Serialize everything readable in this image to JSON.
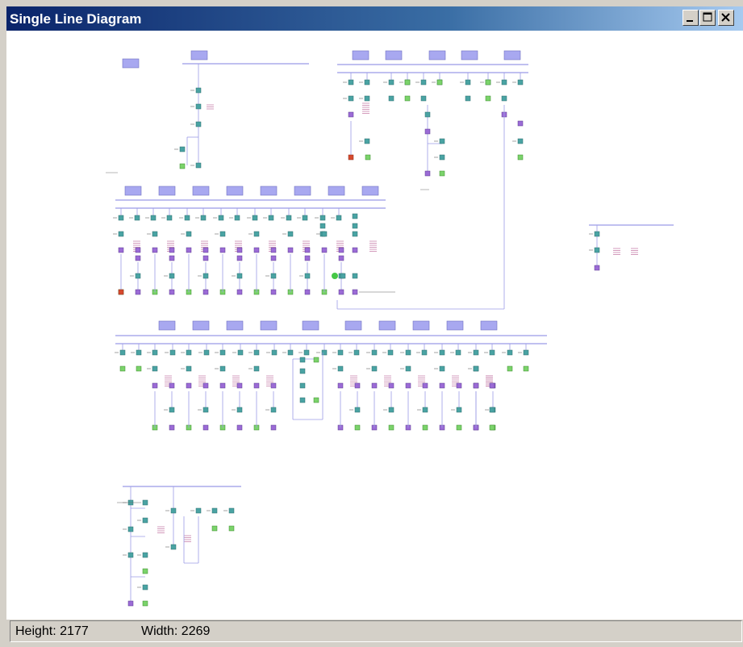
{
  "window": {
    "title": "Single Line Diagram"
  },
  "colors": {
    "bus": "#9b9be6",
    "bus_label": "#a8a8f0",
    "device": "#4aa3a3",
    "transformer": "#9b6bd6",
    "load": "#7bd36b",
    "fault": "#d64a2e",
    "wire": "#9b9be6"
  },
  "status": {
    "height": "Height: 2177",
    "width": "Width: 2269"
  }
}
